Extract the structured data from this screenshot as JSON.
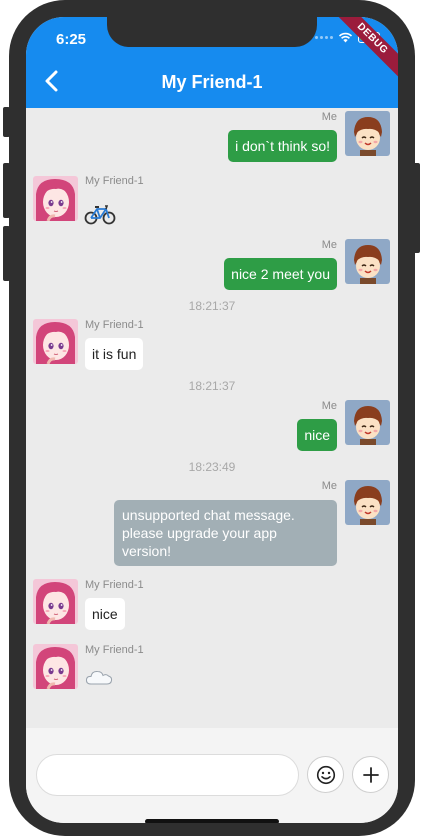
{
  "status_bar": {
    "time": "6:25",
    "debug_label": "DEBUG"
  },
  "app_bar": {
    "title": "My Friend-1",
    "back_icon": "chevron-left-icon"
  },
  "colors": {
    "app_bar": "#168bef",
    "my_bubble": "#2e9d46",
    "friend_bubble": "#ffffff",
    "unsupported_bubble": "#a2afb5",
    "chat_background": "#ebebeb"
  },
  "messages": [
    {
      "sender": "Me",
      "type": "text",
      "text": "i don`t think so!"
    },
    {
      "sender": "My Friend-1",
      "type": "emoji",
      "emoji": "bicycle"
    },
    {
      "sender": "Me",
      "type": "text",
      "text": "nice 2 meet you"
    },
    {
      "type": "timestamp",
      "text": "18:21:37"
    },
    {
      "sender": "My Friend-1",
      "type": "text",
      "text": "it is fun"
    },
    {
      "type": "timestamp",
      "text": "18:21:37"
    },
    {
      "sender": "Me",
      "type": "text",
      "text": "nice"
    },
    {
      "type": "timestamp",
      "text": "18:23:49"
    },
    {
      "sender": "Me",
      "type": "unsupported",
      "text": "unsupported chat message. please upgrade your app version!"
    },
    {
      "sender": "My Friend-1",
      "type": "text",
      "text": "nice"
    },
    {
      "sender": "My Friend-1",
      "type": "emoji",
      "emoji": "cloud"
    }
  ],
  "input_bar": {
    "placeholder": "",
    "value": "",
    "emoji_button_icon": "smiley-icon",
    "add_button_icon": "plus-icon"
  }
}
